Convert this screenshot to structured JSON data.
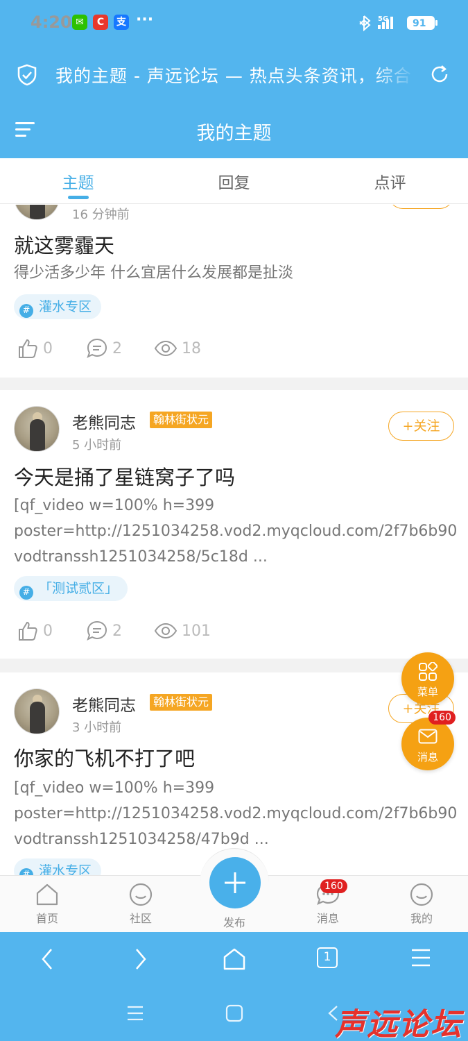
{
  "status_bar": {
    "time": "4:20",
    "dots": "···",
    "network": "5G",
    "battery": "91"
  },
  "browser_bar": {
    "url_title": "我的主题 - 声远论坛 — 热点头条资讯，综合"
  },
  "header": {
    "title": "我的主题"
  },
  "tabs": [
    "主题",
    "回复",
    "点评"
  ],
  "follow_label": "+关注",
  "posts": [
    {
      "time": "16 分钟前",
      "title": "就这雾霾天",
      "body": "得少活多少年 什么宜居什么发展都是扯淡",
      "tag": "灌水专区",
      "likes": "0",
      "comments": "2",
      "views": "18"
    },
    {
      "author": "老熊同志",
      "badge": "翰林街状元",
      "time": "5 小时前",
      "title": "今天是捅了星链窝子了吗",
      "body_lines": [
        "[qf_video w=100% h=399",
        "poster=http://1251034258.vod2.myqcloud.com/2f7b6b90",
        "vodtranssh1251034258/5c18d ..."
      ],
      "tag": "「测试贰区」",
      "likes": "0",
      "comments": "2",
      "views": "101"
    },
    {
      "author": "老熊同志",
      "badge": "翰林街状元",
      "time": "3 小时前",
      "title": "你家的飞机不打了吧",
      "body_lines": [
        "[qf_video w=100% h=399",
        "poster=http://1251034258.vod2.myqcloud.com/2f7b6b90",
        "vodtranssh1251034258/47b9d ..."
      ],
      "tag": "灌水专区"
    }
  ],
  "fabs": {
    "menu_label": "菜单",
    "message_label": "消息",
    "message_count": "160"
  },
  "bottom_nav": {
    "home": "首页",
    "community": "社区",
    "publish": "发布",
    "messages": "消息",
    "messages_count": "160",
    "mine": "我的"
  },
  "browser_nav": {
    "tab_count": "1"
  },
  "watermark": "声远论坛",
  "colors": {
    "primary": "#53b5ee",
    "accent": "#45aee6",
    "orange": "#f5a623",
    "badge_red": "#e02020"
  }
}
